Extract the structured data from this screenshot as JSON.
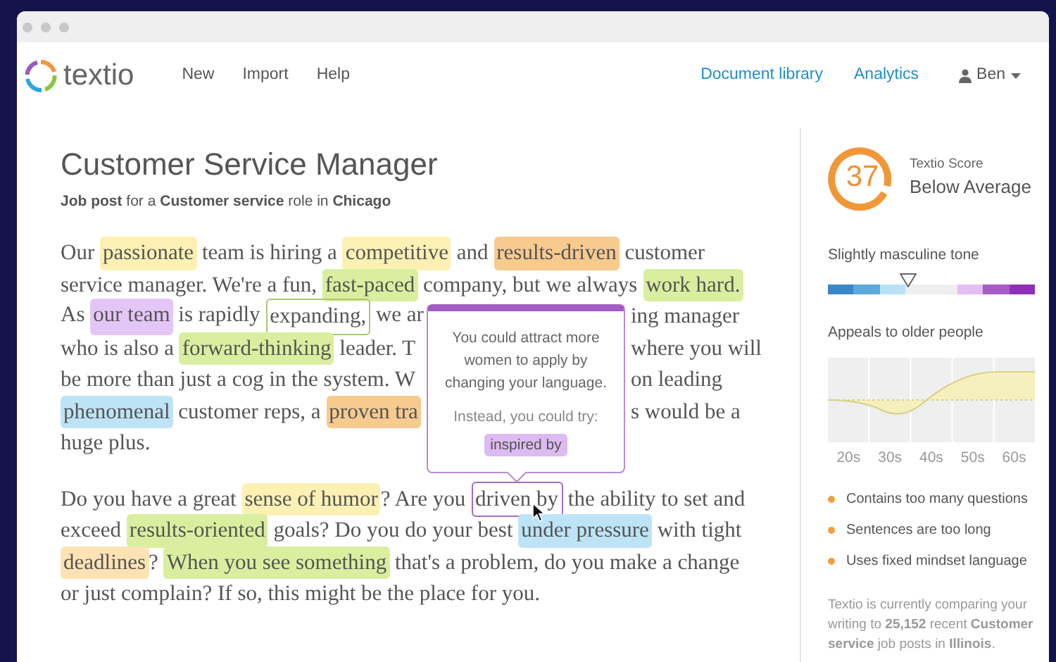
{
  "brand": {
    "name": "textio"
  },
  "nav": {
    "left": [
      "New",
      "Import",
      "Help"
    ],
    "right": [
      "Document library",
      "Analytics"
    ],
    "user": "Ben"
  },
  "document": {
    "title": "Customer Service Manager",
    "subtitle": "**Job post** for a **Customer service** role in **Chicago**",
    "paragraphs": [
      [
        {
          "before": [
            {
              "kind": "plain",
              "text": "Our "
            },
            {
              "kind": "highlight",
              "color": "#fcf1b3",
              "text": "passionate"
            },
            {
              "kind": "plain",
              "text": " team is hiring a "
            },
            {
              "kind": "highlight",
              "color": "#fcf1b3",
              "text": "competitive"
            },
            {
              "kind": "plain",
              "text": " and "
            },
            {
              "kind": "highlight",
              "color": "#f7ca8e",
              "text": "results-driven"
            },
            {
              "kind": "plain",
              "text": " customer"
            }
          ]
        },
        {
          "before": [
            {
              "kind": "plain",
              "text": "service manager. We're a fun, "
            },
            {
              "kind": "highlight",
              "color": "#d9ef9f",
              "text": "fast-paced"
            },
            {
              "kind": "plain",
              "text": " company, but we always "
            },
            {
              "kind": "highlight",
              "color": "#d9ef9f",
              "text": "work hard."
            }
          ]
        },
        {
          "before": [
            {
              "kind": "plain",
              "text": "As "
            },
            {
              "kind": "highlight",
              "color": "#e4c6f6",
              "text": "our team"
            },
            {
              "kind": "plain",
              "text": " is rapidly "
            },
            {
              "kind": "outline",
              "color": "#a9c874",
              "text": "expanding,"
            },
            {
              "kind": "plain",
              "text": " we ar"
            }
          ],
          "after": [
            {
              "kind": "plain",
              "text": "ing manager"
            }
          ]
        },
        {
          "before": [
            {
              "kind": "plain",
              "text": "who is also a "
            },
            {
              "kind": "highlight",
              "color": "#d9ef9f",
              "text": "forward-thinking"
            },
            {
              "kind": "plain",
              "text": " leader. T"
            }
          ],
          "after": [
            {
              "kind": "plain",
              "text": "where you will"
            }
          ]
        },
        {
          "before": [
            {
              "kind": "plain",
              "text": "be more than just a cog in the system. W"
            }
          ],
          "after": [
            {
              "kind": "plain",
              "text": "on leading"
            }
          ]
        },
        {
          "before": [
            {
              "kind": "highlight",
              "color": "#bde4f6",
              "text": "phenomenal"
            },
            {
              "kind": "plain",
              "text": " customer reps, a "
            },
            {
              "kind": "highlight",
              "color": "#f7ca8e",
              "text": "proven tra"
            }
          ],
          "after": [
            {
              "kind": "plain",
              "text": "s would be a"
            }
          ]
        },
        {
          "before": [
            {
              "kind": "plain",
              "text": "huge plus."
            }
          ]
        }
      ],
      [
        {
          "before": [
            {
              "kind": "plain",
              "text": "Do you have a great "
            },
            {
              "kind": "highlight",
              "color": "#fcf1b3",
              "text": "sense of humor"
            },
            {
              "kind": "plain",
              "text": "? Are you "
            },
            {
              "kind": "outline",
              "color": "#a46cc6",
              "text": "driven by"
            },
            {
              "kind": "plain",
              "text": " the ability to set and"
            }
          ]
        },
        {
          "before": [
            {
              "kind": "plain",
              "text": "exceed "
            },
            {
              "kind": "highlight",
              "color": "#d9ef9f",
              "text": "results-oriented"
            },
            {
              "kind": "plain",
              "text": " goals? Do you do your best "
            },
            {
              "kind": "highlight",
              "color": "#bde4f6",
              "text": "under pressure"
            },
            {
              "kind": "plain",
              "text": " with tight"
            }
          ]
        },
        {
          "before": [
            {
              "kind": "highlight",
              "color": "#fde3b4",
              "text": "deadlines"
            },
            {
              "kind": "plain",
              "text": "? "
            },
            {
              "kind": "highlight",
              "color": "#d9ef9f",
              "text": "When you see something"
            },
            {
              "kind": "plain",
              "text": " that's a problem, do you make a change"
            }
          ]
        },
        {
          "before": [
            {
              "kind": "plain",
              "text": "or just complain? If so, this might be the place for you."
            }
          ]
        }
      ]
    ],
    "suggestion": {
      "message": "You could attract more women to apply by changing your language.",
      "prompt": "Instead, you could try:",
      "alternative": "inspired by"
    }
  },
  "sidebar": {
    "score": {
      "value": "37",
      "label": "Textio Score",
      "rating": "Below Average"
    },
    "tone": {
      "label": "Slightly masculine tone"
    },
    "age": {
      "label": "Appeals to older people",
      "ticks": [
        "20s",
        "30s",
        "40s",
        "50s",
        "60s"
      ]
    },
    "issues": [
      "Contains too many questions",
      "Sentences are too long",
      "Uses fixed mindset language"
    ],
    "note": "Textio is currently comparing your writing to **25,152** recent **Customer service** job posts in **Illinois**."
  }
}
